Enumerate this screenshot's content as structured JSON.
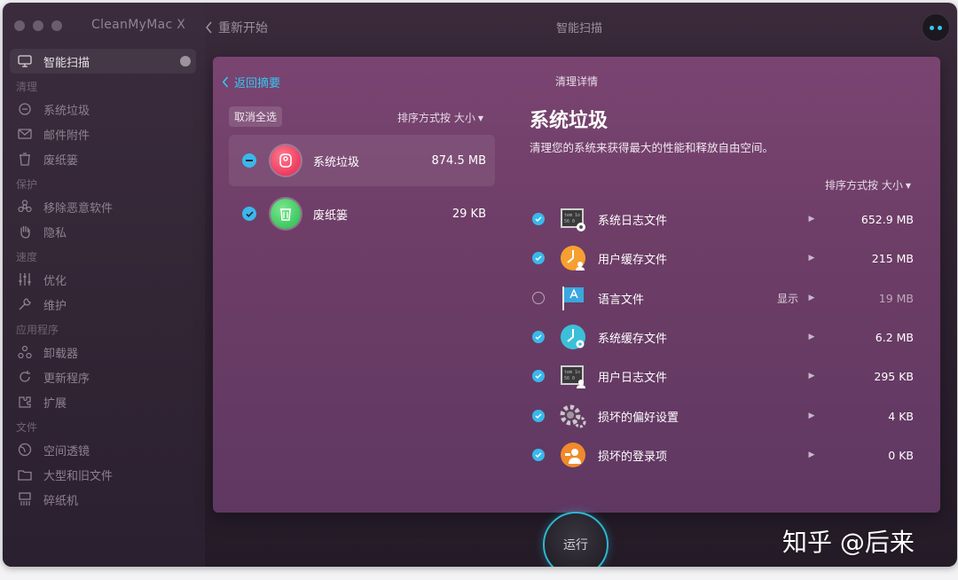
{
  "app": {
    "title": "CleanMyMac X"
  },
  "header": {
    "back_label": "重新开始",
    "title": "智能扫描"
  },
  "sidebar": {
    "items": [
      {
        "type": "item",
        "label": "智能扫描",
        "icon": "monitor-icon",
        "active": true
      },
      {
        "type": "section",
        "label": "清理"
      },
      {
        "type": "item",
        "label": "系统垃圾",
        "icon": "broom-icon"
      },
      {
        "type": "item",
        "label": "邮件附件",
        "icon": "mail-icon"
      },
      {
        "type": "item",
        "label": "废纸篓",
        "icon": "trash-icon"
      },
      {
        "type": "section",
        "label": "保护"
      },
      {
        "type": "item",
        "label": "移除恶意软件",
        "icon": "biohazard-icon"
      },
      {
        "type": "item",
        "label": "隐私",
        "icon": "hand-icon"
      },
      {
        "type": "section",
        "label": "速度"
      },
      {
        "type": "item",
        "label": "优化",
        "icon": "sliders-icon"
      },
      {
        "type": "item",
        "label": "维护",
        "icon": "wrench-icon"
      },
      {
        "type": "section",
        "label": "应用程序"
      },
      {
        "type": "item",
        "label": "卸载器",
        "icon": "uninstaller-icon"
      },
      {
        "type": "item",
        "label": "更新程序",
        "icon": "update-icon"
      },
      {
        "type": "item",
        "label": "扩展",
        "icon": "extension-icon"
      },
      {
        "type": "section",
        "label": "文件"
      },
      {
        "type": "item",
        "label": "空间透镜",
        "icon": "lens-icon"
      },
      {
        "type": "item",
        "label": "大型和旧文件",
        "icon": "folder-icon"
      },
      {
        "type": "item",
        "label": "碎纸机",
        "icon": "shredder-icon"
      }
    ]
  },
  "panel": {
    "back_label": "返回摘要",
    "title": "清理详情",
    "deselect_label": "取消全选",
    "sort_label": "排序方式按 大小",
    "categories": [
      {
        "label": "系统垃圾",
        "size": "874.5 MB",
        "state": "partial",
        "color": "#ee3c5f"
      },
      {
        "label": "废纸篓",
        "size": "29 KB",
        "state": "checked",
        "color": "#3fc760"
      }
    ],
    "section_title": "系统垃圾",
    "section_desc": "清理您的系统来获得最大的性能和释放自由空间。",
    "files_sort_label": "排序方式按 大小",
    "files": [
      {
        "label": "系统日志文件",
        "size": "652.9 MB",
        "checked": true,
        "icon": "log-gear-icon",
        "show": ""
      },
      {
        "label": "用户缓存文件",
        "size": "215 MB",
        "checked": true,
        "icon": "user-cache-icon",
        "show": ""
      },
      {
        "label": "语言文件",
        "size": "19 MB",
        "checked": false,
        "icon": "language-flag-icon",
        "show": "显示"
      },
      {
        "label": "系统缓存文件",
        "size": "6.2 MB",
        "checked": true,
        "icon": "system-cache-icon",
        "show": ""
      },
      {
        "label": "用户日志文件",
        "size": "295 KB",
        "checked": true,
        "icon": "log-user-icon",
        "show": ""
      },
      {
        "label": "损坏的偏好设置",
        "size": "4 KB",
        "checked": true,
        "icon": "gears-icon",
        "show": ""
      },
      {
        "label": "损坏的登录项",
        "size": "0 KB",
        "checked": true,
        "icon": "login-item-icon",
        "show": ""
      }
    ]
  },
  "run_label": "运行",
  "watermark": "知乎 @后来"
}
